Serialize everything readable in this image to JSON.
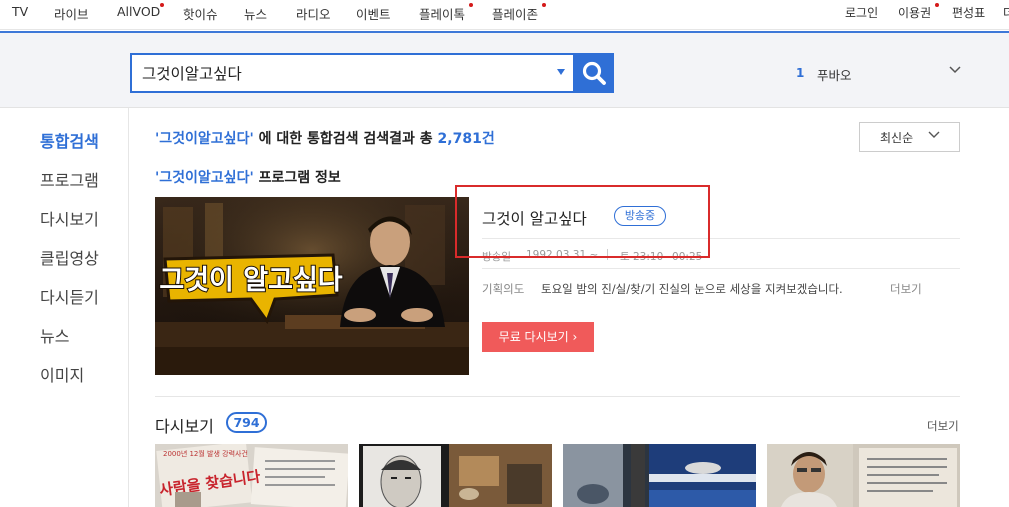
{
  "topnav": {
    "items": [
      "TV",
      "라이브",
      "AllVOD",
      "핫이슈",
      "뉴스",
      "라디오",
      "이벤트",
      "플레이톡",
      "플레이존"
    ],
    "right": [
      "로그인",
      "이용권",
      "편성표",
      "더"
    ]
  },
  "search": {
    "value": "그것이알고싶다",
    "placeholder": ""
  },
  "trending": {
    "rank": "1",
    "keyword": "푸바오"
  },
  "sidebar": {
    "items": [
      "통합검색",
      "프로그램",
      "다시보기",
      "클립영상",
      "다시듣기",
      "뉴스",
      "이미지"
    ]
  },
  "summary": {
    "query": "'그것이알고싶다'",
    "middle": " 에 대한 통합검색 검색결과 총 ",
    "count": "2,781건"
  },
  "sort": {
    "label": "최신순"
  },
  "program": {
    "section_query": "'그것이알고싶다'",
    "section_suffix": " 프로그램 정보",
    "logo_text": "그것이 알고싶다",
    "name": "그것이 알고싶다",
    "status_badge": "방송중",
    "airdate_label": "방송일",
    "airdate": "1992.03.31 ~",
    "schedule": "토 23:10~00:25",
    "plan_label": "기획의도",
    "plan_text": "토요일 밤의 진/실/찾/기 진실의 눈으로 세상을 지켜보겠습니다.",
    "plan_more": "더보기",
    "free_button": "무료 다시보기 ›"
  },
  "replay": {
    "title": "다시보기",
    "count": "794",
    "more": "더보기",
    "thumb1_headline": "사람을 찾습니다",
    "thumb1_top": "2000년 12월 발생 강력사건"
  },
  "colors": {
    "accent": "#2f6fd6",
    "red_button": "#f05a5a",
    "highlight_box": "#d92b2b",
    "new_dot": "#d41a1a"
  }
}
